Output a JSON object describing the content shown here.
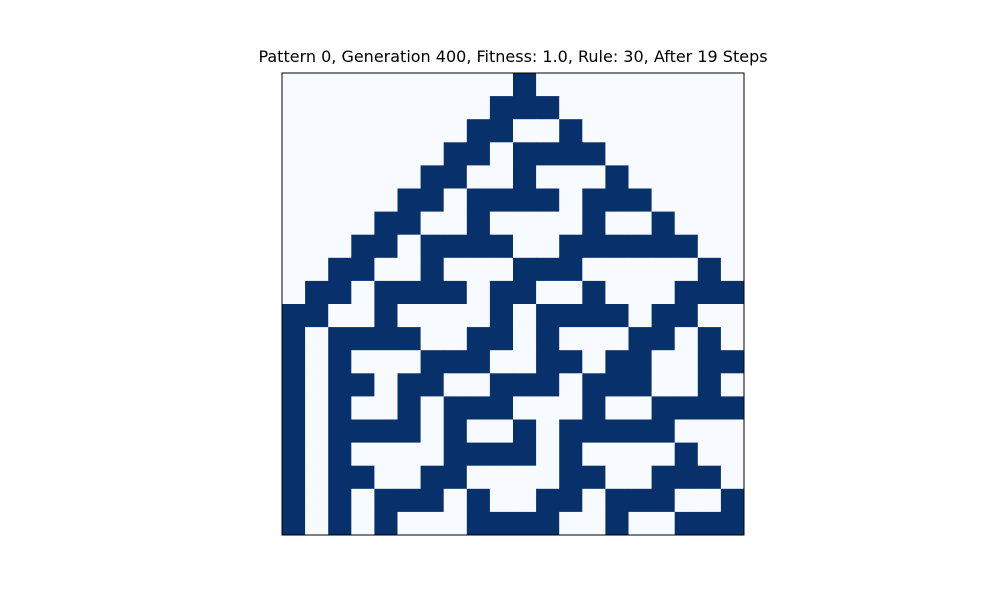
{
  "chart_data": {
    "type": "heatmap",
    "title": "Pattern 0, Generation 400, Fitness: 1.0, Rule: 30, After 19 Steps",
    "colormap": {
      "off": "#f7fbff",
      "on": "#08306b"
    },
    "frame_color": "#000000",
    "grid": false,
    "rows": 20,
    "cols": 20,
    "cells": [
      [
        0,
        0,
        0,
        0,
        0,
        0,
        0,
        0,
        0,
        0,
        1,
        0,
        0,
        0,
        0,
        0,
        0,
        0,
        0,
        0
      ],
      [
        0,
        0,
        0,
        0,
        0,
        0,
        0,
        0,
        0,
        1,
        1,
        1,
        0,
        0,
        0,
        0,
        0,
        0,
        0,
        0
      ],
      [
        0,
        0,
        0,
        0,
        0,
        0,
        0,
        0,
        1,
        1,
        0,
        0,
        1,
        0,
        0,
        0,
        0,
        0,
        0,
        0
      ],
      [
        0,
        0,
        0,
        0,
        0,
        0,
        0,
        1,
        1,
        0,
        1,
        1,
        1,
        1,
        0,
        0,
        0,
        0,
        0,
        0
      ],
      [
        0,
        0,
        0,
        0,
        0,
        0,
        1,
        1,
        0,
        0,
        1,
        0,
        0,
        0,
        1,
        0,
        0,
        0,
        0,
        0
      ],
      [
        0,
        0,
        0,
        0,
        0,
        1,
        1,
        0,
        1,
        1,
        1,
        1,
        0,
        1,
        1,
        1,
        0,
        0,
        0,
        0
      ],
      [
        0,
        0,
        0,
        0,
        1,
        1,
        0,
        0,
        1,
        0,
        0,
        0,
        0,
        1,
        0,
        0,
        1,
        0,
        0,
        0
      ],
      [
        0,
        0,
        0,
        1,
        1,
        0,
        1,
        1,
        1,
        1,
        0,
        0,
        1,
        1,
        1,
        1,
        1,
        1,
        0,
        0
      ],
      [
        0,
        0,
        1,
        1,
        0,
        0,
        1,
        0,
        0,
        0,
        1,
        1,
        1,
        0,
        0,
        0,
        0,
        0,
        1,
        0
      ],
      [
        0,
        1,
        1,
        0,
        1,
        1,
        1,
        1,
        0,
        1,
        1,
        0,
        0,
        1,
        0,
        0,
        0,
        1,
        1,
        1
      ],
      [
        1,
        1,
        0,
        0,
        1,
        0,
        0,
        0,
        0,
        1,
        0,
        1,
        1,
        1,
        1,
        0,
        1,
        1,
        0,
        0
      ],
      [
        1,
        0,
        1,
        1,
        1,
        1,
        0,
        0,
        1,
        1,
        0,
        1,
        0,
        0,
        0,
        1,
        1,
        0,
        1,
        0
      ],
      [
        1,
        0,
        1,
        0,
        0,
        0,
        1,
        1,
        1,
        0,
        0,
        1,
        1,
        0,
        1,
        1,
        0,
        0,
        1,
        1
      ],
      [
        1,
        0,
        1,
        1,
        0,
        1,
        1,
        0,
        0,
        1,
        1,
        1,
        0,
        1,
        1,
        1,
        0,
        0,
        1,
        0
      ],
      [
        1,
        0,
        1,
        0,
        0,
        1,
        0,
        1,
        1,
        1,
        0,
        0,
        0,
        1,
        0,
        0,
        1,
        1,
        1,
        1
      ],
      [
        1,
        0,
        1,
        1,
        1,
        1,
        0,
        1,
        0,
        0,
        1,
        0,
        1,
        1,
        1,
        1,
        1,
        0,
        0,
        0
      ],
      [
        1,
        0,
        1,
        0,
        0,
        0,
        0,
        1,
        1,
        1,
        1,
        0,
        1,
        0,
        0,
        0,
        0,
        1,
        0,
        0
      ],
      [
        1,
        0,
        1,
        1,
        0,
        0,
        1,
        1,
        0,
        0,
        0,
        0,
        1,
        1,
        0,
        0,
        1,
        1,
        1,
        0
      ],
      [
        1,
        0,
        1,
        0,
        1,
        1,
        1,
        0,
        1,
        0,
        0,
        1,
        1,
        0,
        1,
        1,
        1,
        0,
        0,
        1
      ],
      [
        1,
        0,
        1,
        0,
        1,
        0,
        0,
        0,
        1,
        1,
        1,
        1,
        0,
        0,
        1,
        0,
        0,
        1,
        1,
        1
      ]
    ]
  }
}
